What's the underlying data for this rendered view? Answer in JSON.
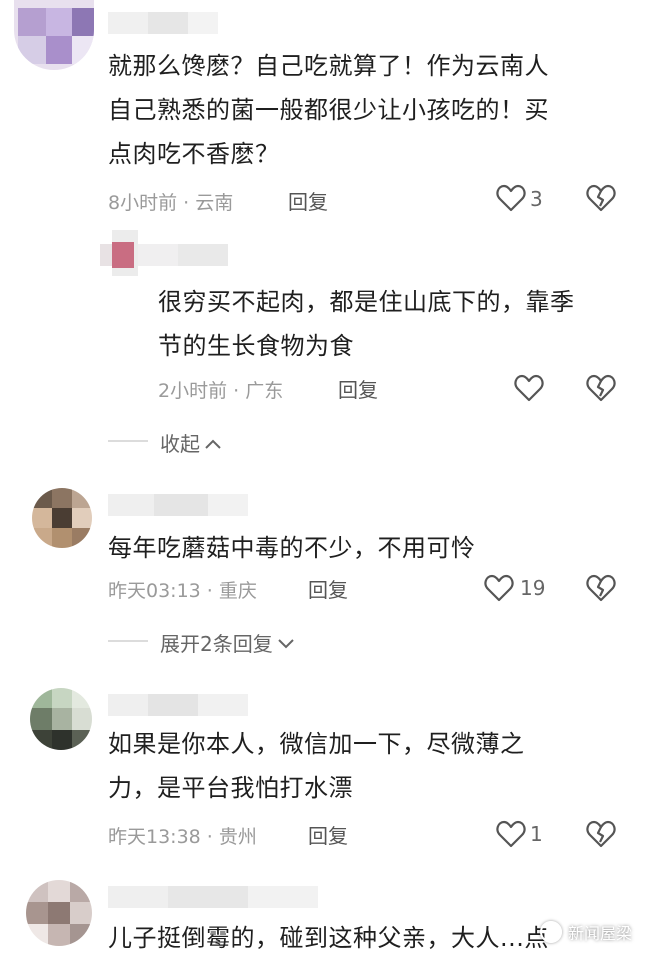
{
  "comments": [
    {
      "text_lines": [
        "就那么馋麽？自己吃就算了！作为云南人",
        "自己熟悉的菌一般都很少让小孩吃的！买",
        "点肉吃不香麽？"
      ],
      "meta": "8小时前 · 云南",
      "reply_label": "回复",
      "likes": "3"
    },
    {
      "text_lines": [
        "很穷买不起肉，都是住山底下的，靠季",
        "节的生长食物为食"
      ],
      "meta": "2小时前 · 广东",
      "reply_label": "回复",
      "likes": "",
      "fold_label": "收起"
    },
    {
      "text_lines": [
        "每年吃蘑菇中毒的不少，不用可怜"
      ],
      "meta": "昨天03:13 · 重庆",
      "reply_label": "回复",
      "likes": "19",
      "expand_label": "展开2条回复"
    },
    {
      "text_lines": [
        "如果是你本人，微信加一下，尽微薄之",
        "力，是平台我怕打水漂"
      ],
      "meta": "昨天13:38 · 贵州",
      "reply_label": "回复",
      "likes": "1"
    },
    {
      "text_lines": [
        "儿子挺倒霉的，碰到这种父亲，大人...点"
      ]
    }
  ],
  "watermark": "新闻屋梁",
  "icons": {
    "like": "heart-outline-icon",
    "dislike": "broken-heart-icon",
    "fold": "chevron-up-icon",
    "expand": "chevron-down-icon"
  }
}
